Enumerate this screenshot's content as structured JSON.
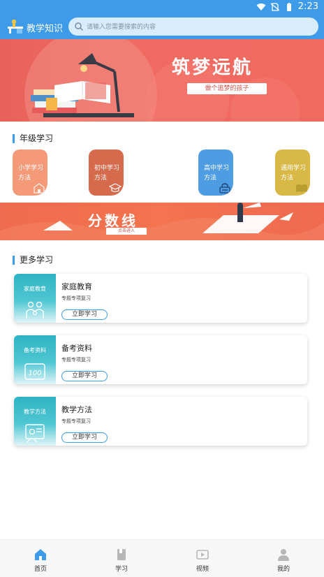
{
  "status_bar": {
    "time": "2:23"
  },
  "header": {
    "app_title": "教学知识",
    "search": {
      "placeholder": "请输入您需要搜索的内容"
    }
  },
  "banner": {
    "title": "筑梦远航",
    "subtitle": "做个追梦的孩子"
  },
  "grade_section": {
    "title": "年级学习",
    "cards": [
      {
        "label": "小学学习方法",
        "color": "#f49a79",
        "icon": "school-icon"
      },
      {
        "label": "初中学习方法",
        "color": "#d66a4d",
        "icon": "graduation-cap-icon"
      },
      {
        "label": "高中学习方法",
        "color": "#4e9de2",
        "icon": "lock-icon"
      },
      {
        "label": "通用学习方法",
        "color": "#d8b948",
        "icon": "book-icon"
      }
    ]
  },
  "banner2": {
    "title": "分数线",
    "subtitle": "点击进入"
  },
  "more_section": {
    "title": "更多学习",
    "items": [
      {
        "thumb_label": "家庭教育",
        "title": "家庭教育",
        "subtitle": "专题专项复习",
        "button": "立即学习",
        "icon": "family-icon"
      },
      {
        "thumb_label": "备考资料",
        "title": "备考资料",
        "subtitle": "专题专项复习",
        "button": "立即学习",
        "icon": "score-100-icon"
      },
      {
        "thumb_label": "教学方法",
        "title": "教学方法",
        "subtitle": "专题专项复习",
        "button": "立即学习",
        "icon": "teacher-board-icon"
      }
    ]
  },
  "tabbar": {
    "items": [
      {
        "label": "首页",
        "icon": "home-icon",
        "active": true
      },
      {
        "label": "学习",
        "icon": "book-icon"
      },
      {
        "label": "视频",
        "icon": "video-icon"
      },
      {
        "label": "我的",
        "icon": "user-icon"
      }
    ]
  },
  "colors": {
    "primary": "#3d9be9",
    "banner": "#ef6b62",
    "card_thumb": "#2fb3c2",
    "active_tab": "#3d9be9"
  }
}
